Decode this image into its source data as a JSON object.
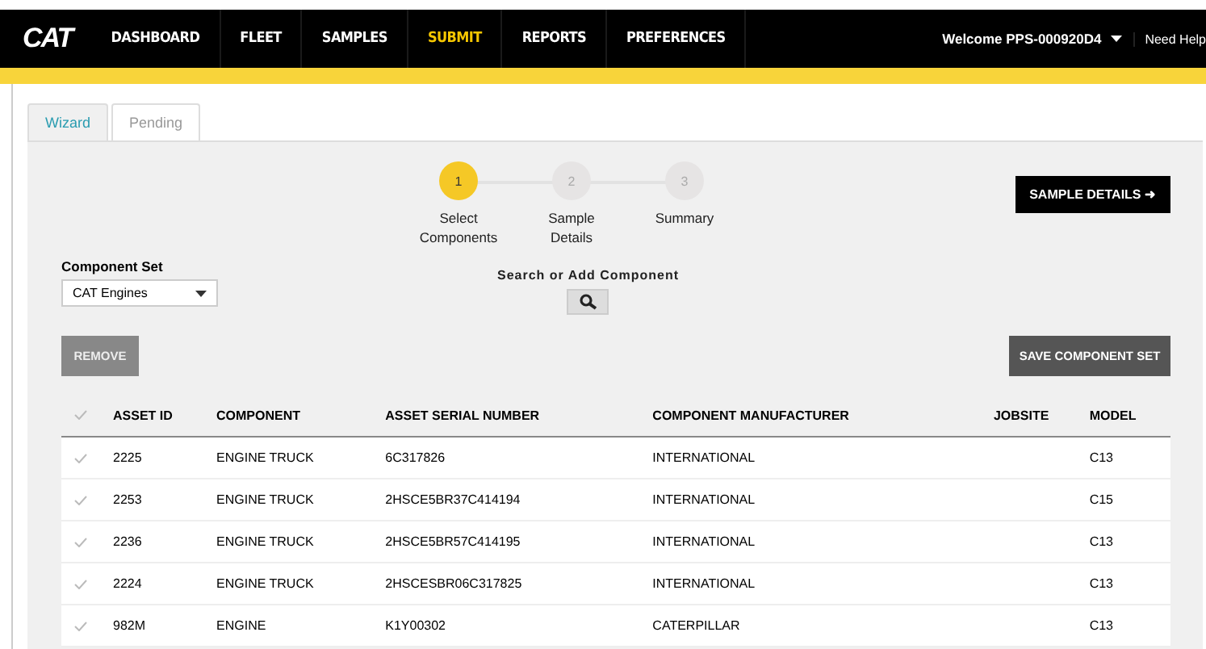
{
  "nav": {
    "logo": "CAT",
    "items": [
      {
        "label": "DASHBOARD",
        "selected": false
      },
      {
        "label": "FLEET",
        "selected": false
      },
      {
        "label": "SAMPLES",
        "selected": false
      },
      {
        "label": "SUBMIT",
        "selected": true
      },
      {
        "label": "REPORTS",
        "selected": false
      },
      {
        "label": "PREFERENCES",
        "selected": false
      }
    ],
    "welcome": "Welcome PPS-000920D4",
    "help": "Need Help"
  },
  "tabs": [
    {
      "label": "Wizard",
      "selected": true
    },
    {
      "label": "Pending",
      "selected": false
    }
  ],
  "steps": [
    {
      "number": "1",
      "label": "Select Components",
      "selected": true
    },
    {
      "number": "2",
      "label": "Sample Details",
      "selected": false
    },
    {
      "number": "3",
      "label": "Summary",
      "selected": false
    }
  ],
  "sample_details_button": "SAMPLE DETAILS ➜",
  "component_set": {
    "label": "Component Set",
    "value": "CAT Engines"
  },
  "search_label": "Search or Add Component",
  "remove_button": "REMOVE",
  "save_button": "SAVE COMPONENT SET",
  "table": {
    "columns": [
      "ASSET ID",
      "COMPONENT",
      "ASSET SERIAL NUMBER",
      "COMPONENT MANUFACTURER",
      "JOBSITE",
      "MODEL"
    ],
    "rows": [
      [
        "2225",
        "ENGINE TRUCK",
        "6C317826",
        "INTERNATIONAL",
        "",
        "C13"
      ],
      [
        "2253",
        "ENGINE TRUCK",
        "2HSCE5BR37C414194",
        "INTERNATIONAL",
        "",
        "C15"
      ],
      [
        "2236",
        "ENGINE TRUCK",
        "2HSCE5BR57C414195",
        "INTERNATIONAL",
        "",
        "C13"
      ],
      [
        "2224",
        "ENGINE TRUCK",
        "2HSCESBR06C317825",
        "INTERNATIONAL",
        "",
        "C13"
      ],
      [
        "982M",
        "ENGINE",
        "K1Y00302",
        "CATERPILLAR",
        "",
        "C13"
      ]
    ]
  }
}
